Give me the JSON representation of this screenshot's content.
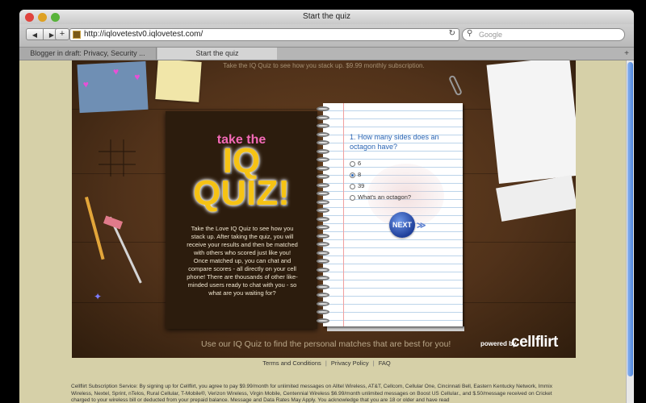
{
  "window": {
    "title": "Start the quiz"
  },
  "toolbar": {
    "url": "http://iqlovetestv0.iqlovetest.com/",
    "search_placeholder": "Google",
    "add_label": "+"
  },
  "tabs": [
    {
      "label": "Blogger in draft: Privacy, Security ..."
    },
    {
      "label": "Start the quiz"
    }
  ],
  "stage": {
    "top_banner": "Take the IQ Quiz to see how you stack up. $9.99 monthly subscription.",
    "cover": {
      "take_the": "take the",
      "title_line1": "IQ",
      "title_line2": "QUIZ!",
      "description": "Take the Love IQ Quiz to see how you stack up. After taking the quiz, you will receive your results and then be matched with others who scored just like you! Once matched up, you can chat and compare scores - all directly on your cell phone! There are thousands of other like-minded users ready to chat with you - so what are you waiting for?"
    },
    "quiz": {
      "question": "1. How many sides does an octagon have?",
      "options": [
        {
          "label": "6",
          "selected": false
        },
        {
          "label": "8",
          "selected": true
        },
        {
          "label": "39",
          "selected": false
        },
        {
          "label": "What's an octagon?",
          "selected": false
        }
      ],
      "next_label": "NEXT",
      "next_arrows": "≫"
    },
    "bottom_banner": "Use our IQ Quiz to find the personal matches that are best for you!",
    "powered_by": "powered by",
    "brand": "cellflirt"
  },
  "footer": {
    "links": [
      "Terms and Conditions",
      "Privacy Policy",
      "FAQ"
    ],
    "separator": "|",
    "legal": "Cellflirt Subscription Service: By signing up for Cellflirt, you agree to pay $9.99/month for unlimited messages on Alltel Wireless, AT&T, Cellcom, Cellular One, Cincinnati Bell, Eastern Kentucky Network, Immix Wireless, Nextel, Sprint, nTelos, Rural Cellular, T-Mobile®, Verizon Wireless, Virgin Mobile, Centennial Wireless $6.99/month unlimited messages on Boost US Cellular., and $.50/message received on Cricket charged to your wireless bill or deducted from your prepaid balance. Message and Data Rates May Apply. You acknowledge that you are 18 or older and have read"
  },
  "colors": {
    "accent_pink": "#f36ab7",
    "quiz_title_yellow": "#f6c314",
    "question_blue": "#2a65b4",
    "page_background": "#d6d0a8"
  }
}
